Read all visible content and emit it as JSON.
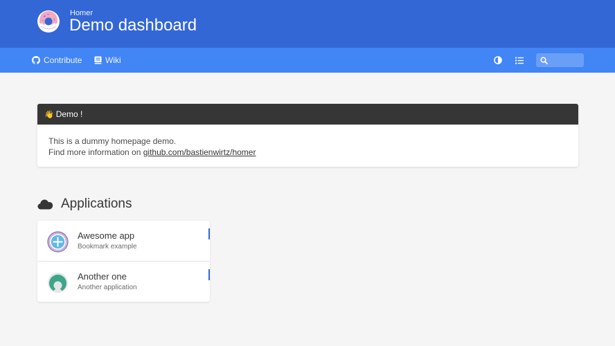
{
  "header": {
    "subtitle": "Homer",
    "title": "Demo dashboard",
    "background": "#3367d6"
  },
  "navbar": {
    "background": "#4285f4",
    "links": [
      {
        "label": "Contribute",
        "icon": "github-icon"
      },
      {
        "label": "Wiki",
        "icon": "book-icon"
      }
    ],
    "darkmode_icon": "half-circle-icon",
    "layout_icon": "list-icon",
    "search": {
      "value": "",
      "placeholder": ""
    }
  },
  "message": {
    "icon": "waving-hand-icon",
    "title": "Demo !",
    "line1": "This is a dummy homepage demo.",
    "line2_prefix": "Find more information on ",
    "link_text": "github.com/bastienwirtz/homer",
    "header_background": "#363636"
  },
  "group": {
    "icon": "cloud-icon",
    "title": "Applications",
    "items": [
      {
        "name": "Awesome app",
        "subtitle": "Bookmark example",
        "icon": "plus-circle-icon"
      },
      {
        "name": "Another one",
        "subtitle": "Another application",
        "icon": "open-source-icon"
      }
    ],
    "accent": "#3367d6"
  }
}
